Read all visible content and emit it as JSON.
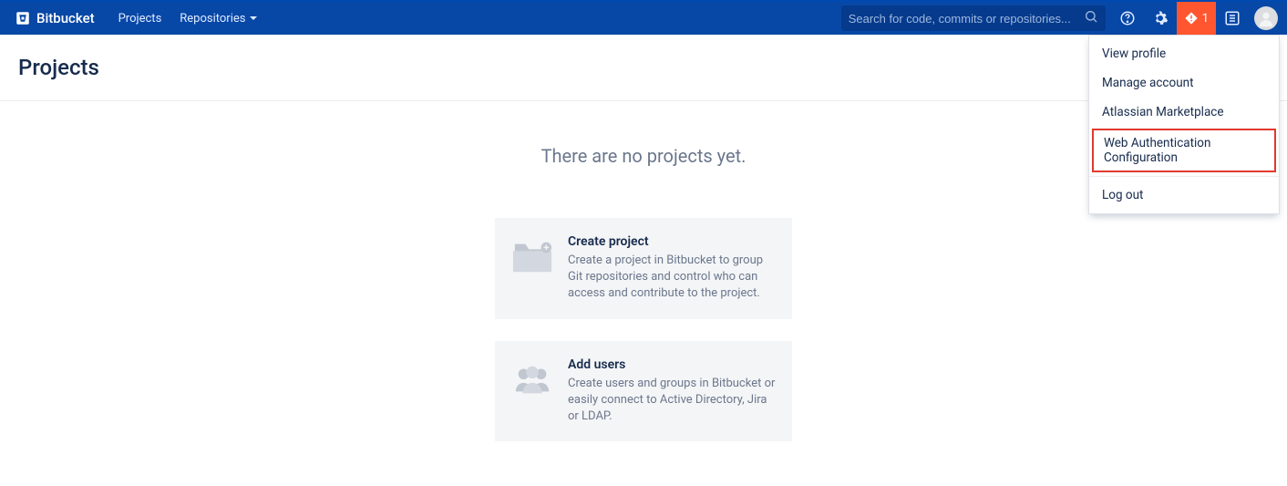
{
  "nav": {
    "brand": "Bitbucket",
    "links": {
      "projects": "Projects",
      "repositories": "Repositories"
    },
    "search_placeholder": "Search for code, commits or repositories...",
    "alert_count": "1"
  },
  "page": {
    "title": "Projects"
  },
  "empty": {
    "heading": "There are no projects yet."
  },
  "cards": {
    "create_project": {
      "title": "Create project",
      "desc": "Create a project in Bitbucket to group Git repositories and control who can access and contribute to the project."
    },
    "add_users": {
      "title": "Add users",
      "desc": "Create users and groups in Bitbucket or easily connect to Active Directory, Jira or LDAP."
    }
  },
  "profile_menu": {
    "view_profile": "View profile",
    "manage_account": "Manage account",
    "marketplace": "Atlassian Marketplace",
    "web_auth_config": "Web Authentication Configuration",
    "log_out": "Log out"
  }
}
